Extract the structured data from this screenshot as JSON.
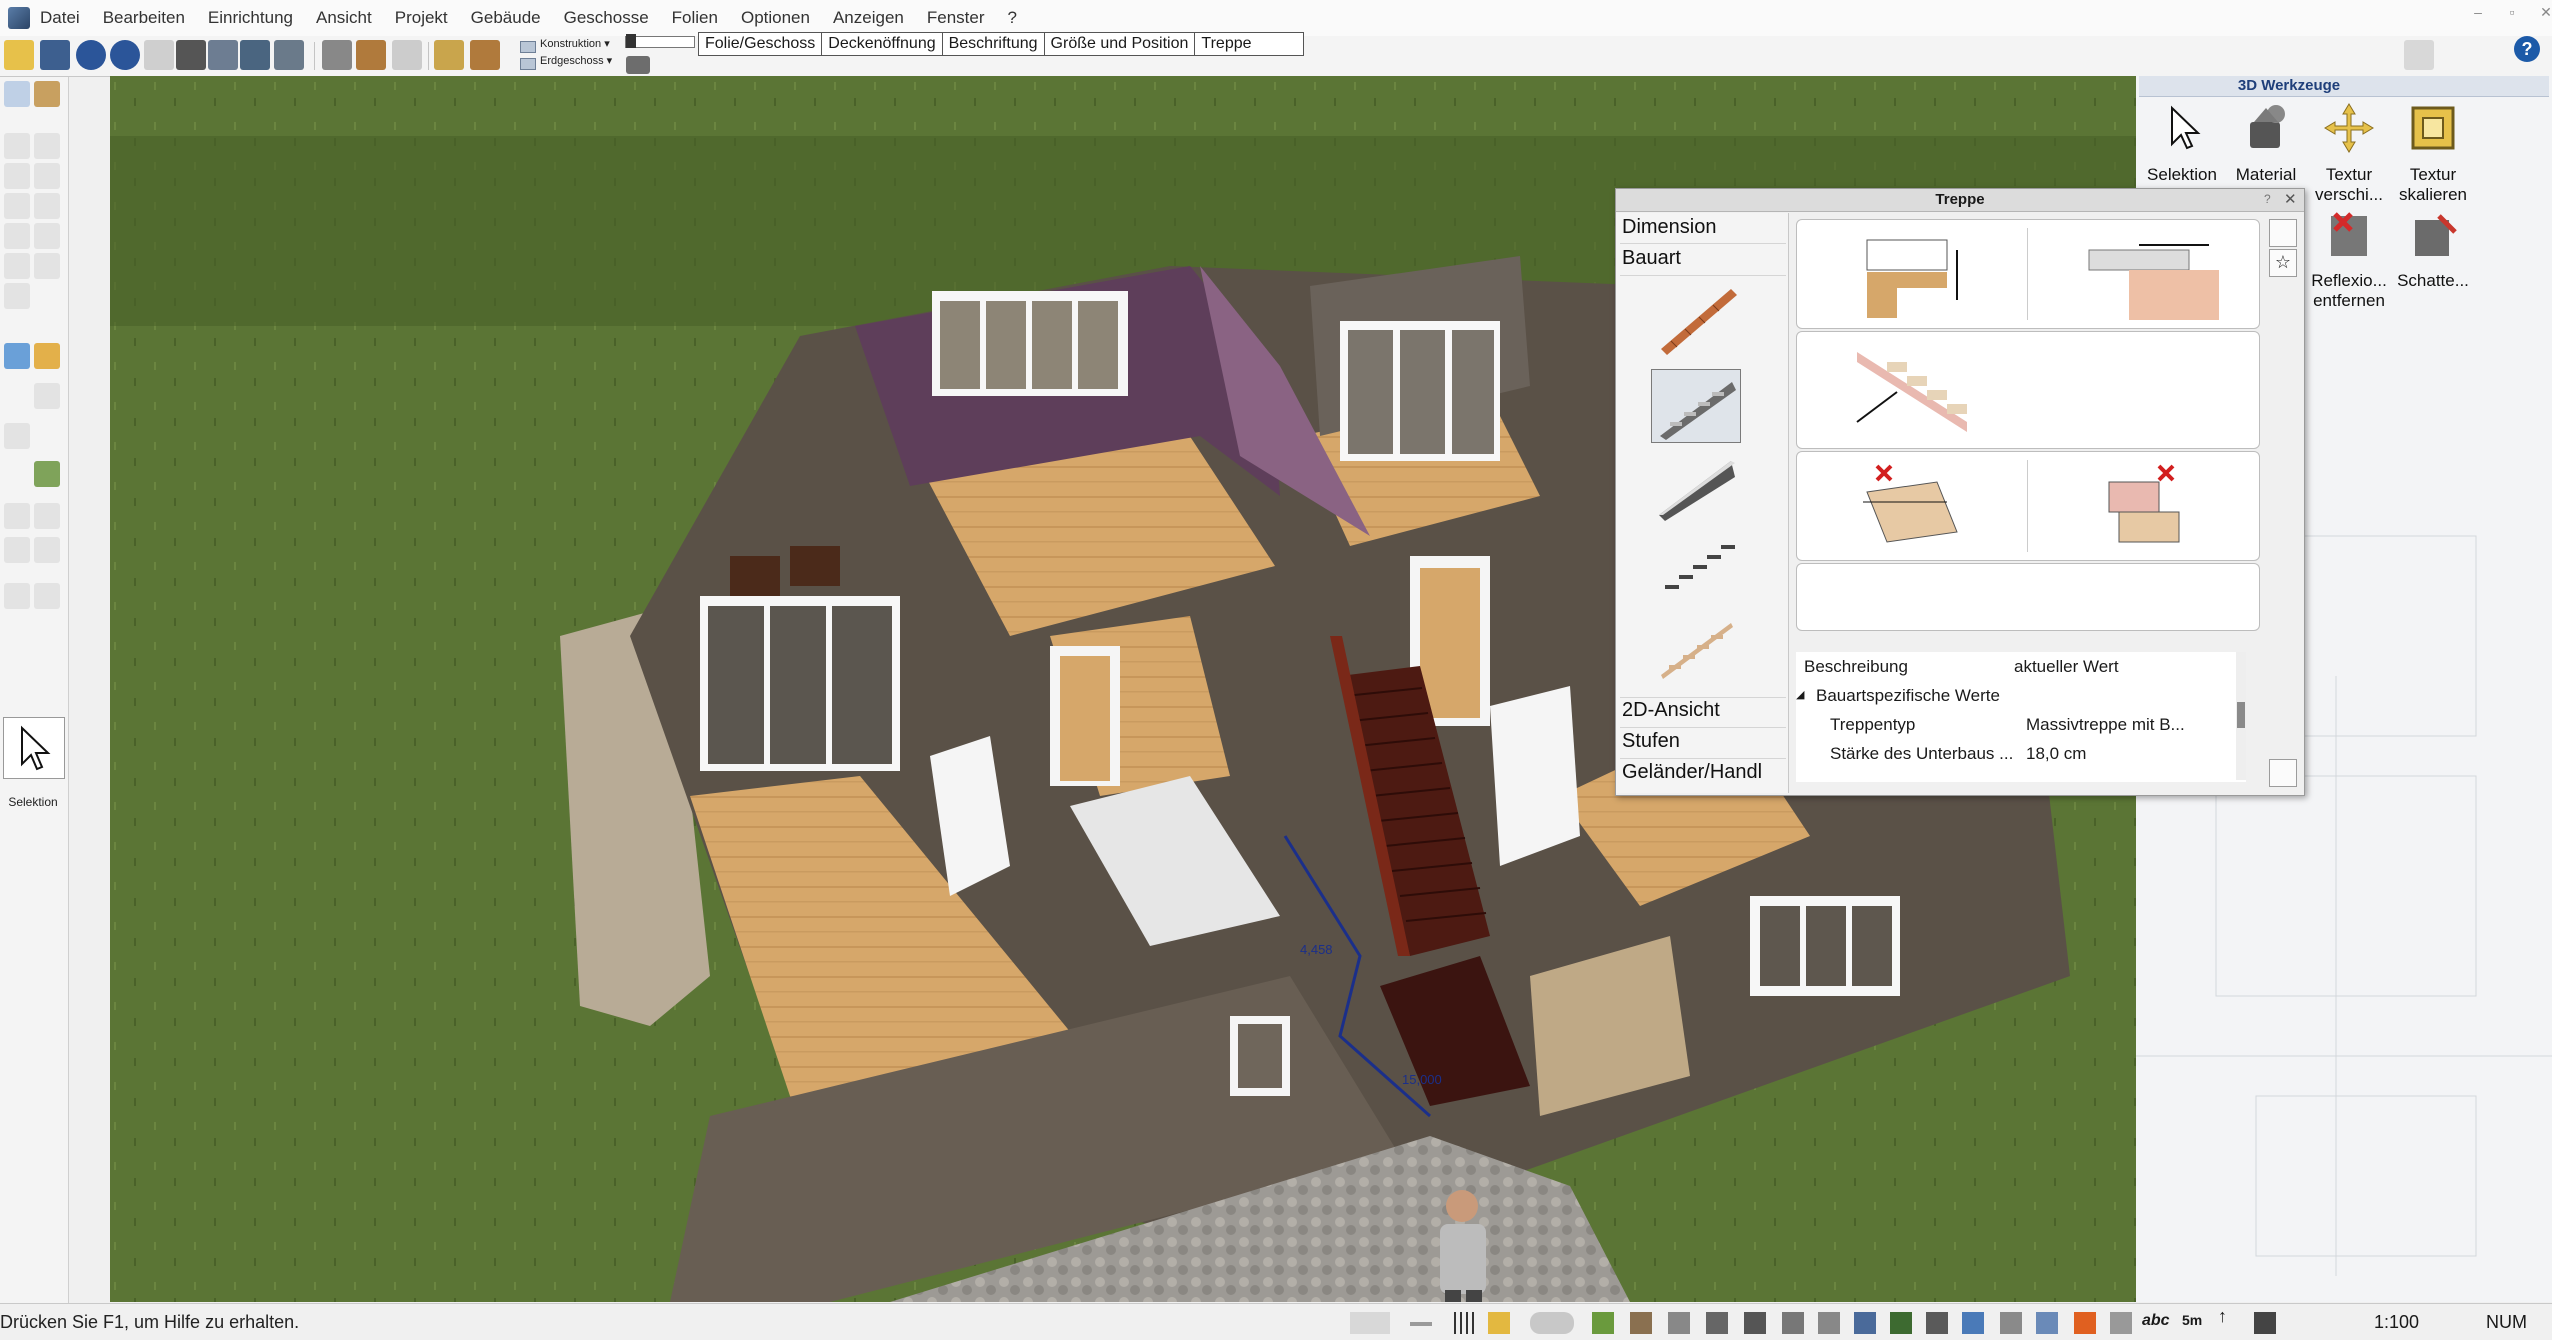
{
  "menu": {
    "items": [
      "Datei",
      "Bearbeiten",
      "Einrichtung",
      "Ansicht",
      "Projekt",
      "Gebäude",
      "Geschosse",
      "Folien",
      "Optionen",
      "Anzeigen",
      "Fenster",
      "?"
    ],
    "window_controls": [
      "–",
      "▫",
      "✕"
    ]
  },
  "toolbar": {
    "layer_construction": "Konstruktion ▾",
    "layer_floor": "Erdgeschoss ▾",
    "tabs": [
      "Folie/Geschoss",
      "Deckenöffnung",
      "Beschriftung",
      "Größe und Position",
      "Treppe"
    ],
    "help_label": "?"
  },
  "left_tools": {
    "selection_label": "Selektion"
  },
  "viewport": {
    "dimension_a": "4,458",
    "dimension_b": "15,000"
  },
  "tools_panel": {
    "title": "3D Werkzeuge",
    "tools": [
      {
        "label": "Selektion"
      },
      {
        "label": "Material"
      },
      {
        "label": "Textur verschi..."
      },
      {
        "label": "Textur skalieren"
      },
      {
        "label": "Reflexio... entfernen"
      },
      {
        "label": "Schatte..."
      }
    ]
  },
  "treppe_dialog": {
    "title": "Treppe",
    "sections": {
      "dimension": "Dimension",
      "bauart": "Bauart",
      "ansicht2d": "2D-Ansicht",
      "stufen": "Stufen",
      "gelaender": "Geländer/Handl"
    },
    "properties": {
      "header_key": "Beschreibung",
      "header_value": "aktueller Wert",
      "group": "Bauartspezifische Werte",
      "rows": [
        {
          "key": "Treppentyp",
          "value": "Massivtreppe mit B..."
        },
        {
          "key": "Stärke des Unterbaus ...",
          "value": "18,0 cm"
        }
      ]
    }
  },
  "statusbar": {
    "message": "Drücken Sie F1, um Hilfe zu erhalten.",
    "scale": "1:100",
    "num": "NUM",
    "abc": "abc",
    "five_m": "5m"
  }
}
